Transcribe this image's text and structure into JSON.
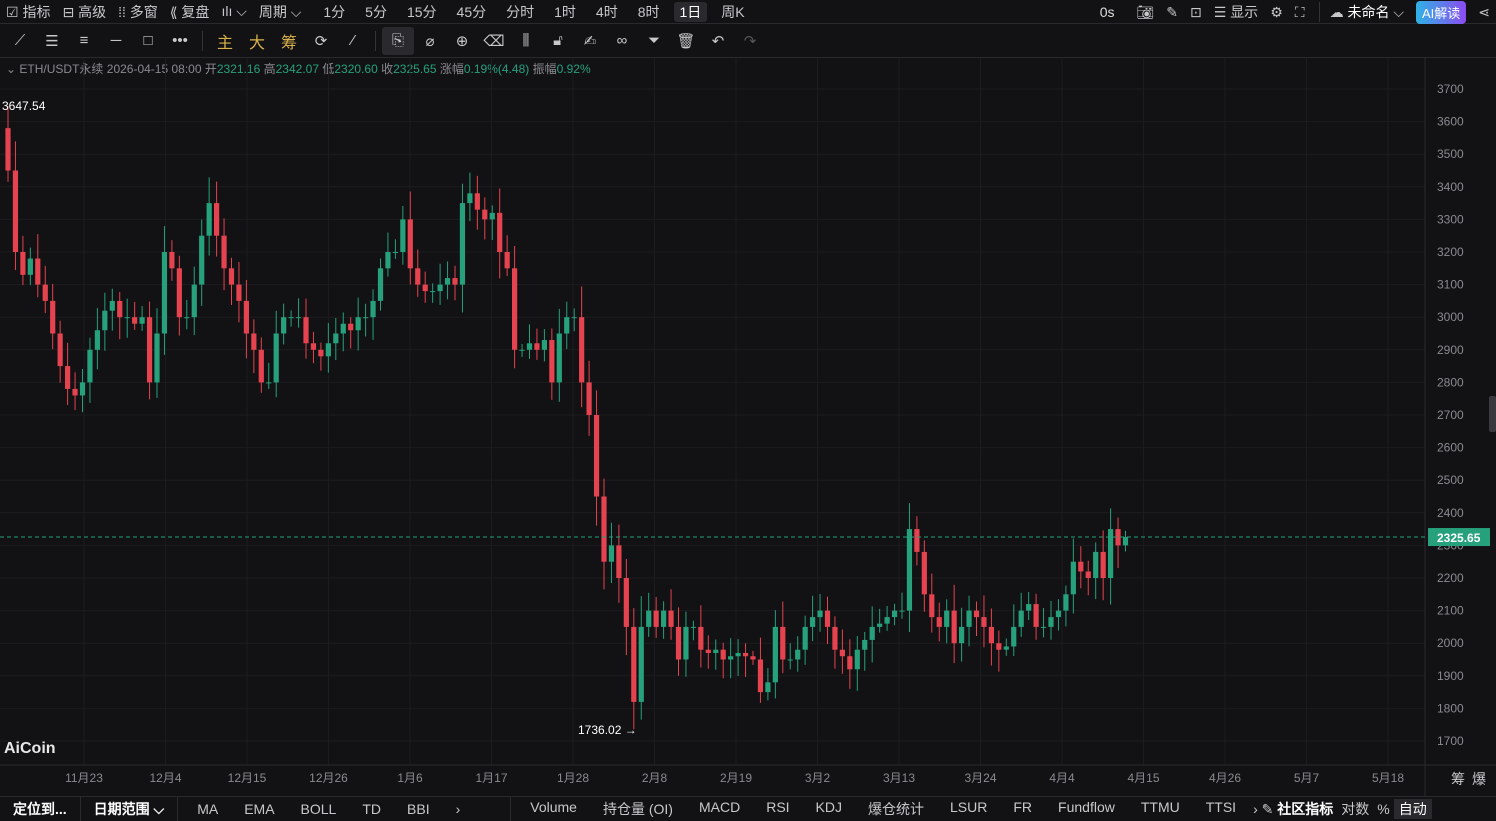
{
  "topbar": {
    "left": [
      {
        "label": "☑ 指标",
        "name": "indicators"
      },
      {
        "label": "⊟ 高级",
        "name": "advanced"
      },
      {
        "label": "⁞⁞ 多窗",
        "name": "multi-window"
      },
      {
        "label": "⟪ 复盘",
        "name": "replay"
      },
      {
        "label": "ılı ⌵",
        "name": "chart-type"
      },
      {
        "label": "周期 ⌵",
        "name": "period"
      }
    ],
    "periods": [
      "1分",
      "5分",
      "15分",
      "45分",
      "分时",
      "1时",
      "4时",
      "8时",
      "1日",
      "周K"
    ],
    "active_period": "1日",
    "countdown": "0s",
    "display": "显示",
    "layout_name": "未命名",
    "ai_label": "AI解读"
  },
  "tools": {
    "main": "主",
    "big": "大",
    "chip": "筹"
  },
  "info": {
    "symbol": "ETH/USDT永续",
    "datetime": "2026-04-15 08:00",
    "open_label": "开",
    "open": "2321.16",
    "high_label": "高",
    "high": "2342.07",
    "low_label": "低",
    "low": "2320.60",
    "close_label": "收",
    "close": "2325.65",
    "change_label": "涨幅",
    "change": "0.19%(4.48)",
    "amp_label": "振幅",
    "amp": "0.92%"
  },
  "colors": {
    "up": "#26a17b",
    "down": "#e5434f",
    "bg": "#121214"
  },
  "chart_data": {
    "type": "candlestick",
    "ylim": [
      1650,
      3780
    ],
    "yticks": [
      1700,
      1800,
      1900,
      2000,
      2100,
      2200,
      2300,
      2400,
      2500,
      2600,
      2700,
      2800,
      2900,
      3000,
      3100,
      3200,
      3300,
      3400,
      3500,
      3600,
      3700
    ],
    "xticks": [
      "11月23",
      "12月4",
      "12月15",
      "12月26",
      "1月6",
      "1月17",
      "1月28",
      "2月8",
      "2月19",
      "3月2",
      "3月13",
      "3月24",
      "4月4",
      "4月15",
      "4月26",
      "5月7",
      "5月18"
    ],
    "first_open": 3580,
    "closes": [
      3450,
      3200,
      3130,
      3180,
      3100,
      3050,
      2950,
      2850,
      2780,
      2760,
      2800,
      2900,
      2960,
      3020,
      3050,
      3000,
      3000,
      2980,
      3000,
      2800,
      2950,
      3200,
      3150,
      3000,
      3000,
      3100,
      3250,
      3350,
      3250,
      3150,
      3100,
      3050,
      2950,
      2900,
      2800,
      2800,
      2950,
      3000,
      3000,
      3000,
      2920,
      2900,
      2880,
      2920,
      2950,
      2980,
      2960,
      3000,
      3000,
      3050,
      3150,
      3200,
      3200,
      3300,
      3150,
      3100,
      3080,
      3080,
      3100,
      3120,
      3100,
      3350,
      3380,
      3330,
      3300,
      3320,
      3200,
      3150,
      2900,
      2900,
      2920,
      2900,
      2930,
      2800,
      2950,
      3000,
      3000,
      2800,
      2700,
      2450,
      2250,
      2300,
      2200,
      2050,
      1820,
      2050,
      2100,
      2050,
      2100,
      2050,
      1950,
      2050,
      2050,
      1980,
      1970,
      1980,
      1950,
      1960,
      1970,
      1960,
      1950,
      1850,
      1880,
      2050,
      1950,
      1950,
      1980,
      2050,
      2080,
      2100,
      2050,
      1980,
      1960,
      1920,
      1980,
      2010,
      2050,
      2060,
      2080,
      2100,
      2100,
      2350,
      2280,
      2150,
      2080,
      2050,
      2100,
      2000,
      2050,
      2100,
      2080,
      2050,
      2000,
      1980,
      1990,
      2050,
      2100,
      2120,
      2050,
      2050,
      2080,
      2100,
      2150,
      2250,
      2220,
      2200,
      2280,
      2200,
      2350,
      2300,
      2325.65
    ],
    "max_label": "3647.54",
    "min_label": "1736.02 →",
    "last_price": "2325.65",
    "last": 2325.65
  },
  "watermark": "AiCoin",
  "axis_corner": [
    "筹",
    "爆"
  ],
  "bottom": {
    "locate": "定位到...",
    "date_range": "日期范围 ⌵",
    "main_ind": [
      "MA",
      "EMA",
      "BOLL",
      "TD",
      "BBI"
    ],
    "sub_ind": [
      "Volume",
      "持仓量 (OI)",
      "MACD",
      "RSI",
      "KDJ",
      "爆仓统计",
      "LSUR",
      "FR",
      "Fundflow",
      "TTMU",
      "TTSI"
    ],
    "community": "社区指标",
    "log": "对数",
    "pct": "%",
    "auto": "自动"
  }
}
